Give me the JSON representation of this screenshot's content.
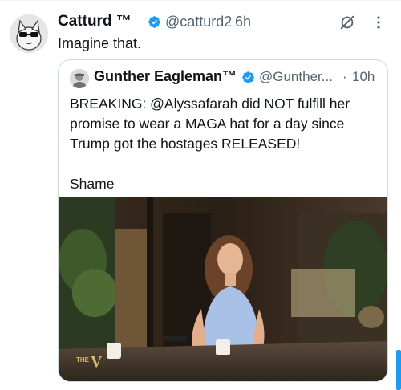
{
  "tweet": {
    "author_name": "Catturd ™",
    "author_handle": "@catturd2",
    "separator": "·",
    "time": "6h",
    "text": "Imagine that."
  },
  "quoted_tweet": {
    "author_name": "Gunther Eagleman™",
    "author_handle": "@Gunther...",
    "separator": "·",
    "time": "10h",
    "body_line_1": "BREAKING: @Alyssafarah did NOT fulfill her promise to wear a MAGA hat for a day since Trump got the hostages RELEASED!",
    "body_line_2": "Shame"
  },
  "colors": {
    "verified_badge": "#1d9bf0",
    "secondary_text": "#536471",
    "border": "#cfd9de",
    "accent": "#1d9bf0"
  },
  "icons": {
    "verified": "verified-check-icon",
    "grok": "grok-icon",
    "more": "more-options-icon"
  }
}
